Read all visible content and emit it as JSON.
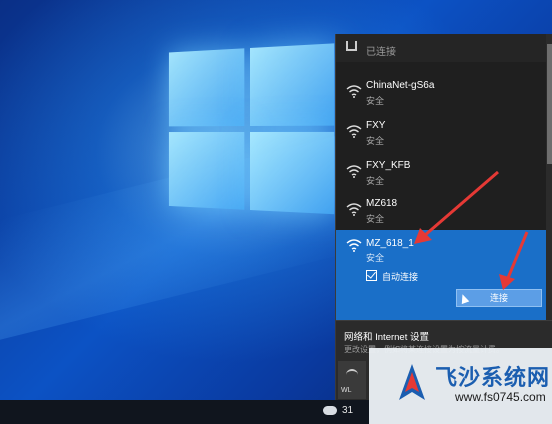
{
  "flyout": {
    "status_text": "已连接",
    "networks": [
      {
        "name": "ChinaNet-gS6a",
        "security": "安全"
      },
      {
        "name": "FXY",
        "security": "安全"
      },
      {
        "name": "FXY_KFB",
        "security": "安全"
      },
      {
        "name": "MZ618",
        "security": "安全"
      }
    ],
    "selected_network": {
      "name": "MZ_618_1",
      "security": "安全",
      "auto_connect_label": "自动连接",
      "auto_connect_checked": true,
      "connect_button_label": "连接"
    },
    "settings": {
      "title": "网络和 Internet 设置",
      "subtitle": "更改设置，例如将某连接设置为按流量计费。",
      "quick_tile_label": "WL"
    }
  },
  "taskbar": {
    "tray_text": "31"
  },
  "watermark": {
    "title": "飞沙系统网",
    "url": "www.fs0745.com"
  },
  "colors": {
    "flyout_bg": "#1f1f1f",
    "selected_bg": "#1a6fc8",
    "arrow": "#e53935",
    "brand": "#1b5eb0"
  }
}
